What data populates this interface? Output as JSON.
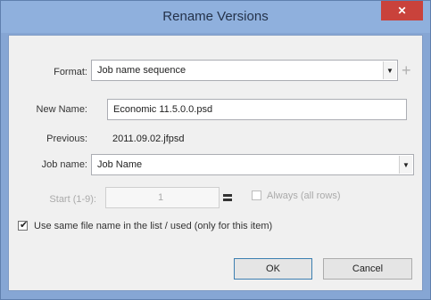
{
  "window": {
    "title": "Rename Versions",
    "close_label": "✕"
  },
  "form": {
    "format_label": "Format:",
    "format_value": "Job name sequence",
    "new_name_label": "New Name:",
    "new_name_value": "Economic 11.5.0.0.psd",
    "previous_label": "Previous:",
    "previous_value": "2011.09.02.jfpsd",
    "job_name_label": "Job name:",
    "job_name_value": "Job Name",
    "start_label": "Start (1-9):",
    "start_value": "1",
    "always_label": "Always (all rows)",
    "apply_label": "Use same file name in the list / used (only for this item)"
  },
  "buttons": {
    "ok_label": "OK",
    "cancel_label": "Cancel"
  },
  "icons": {
    "dropdown_arrow": "chevron-down-icon",
    "plus": "plus-icon",
    "spin": "spin-arrows-icon",
    "check": "check-icon"
  }
}
